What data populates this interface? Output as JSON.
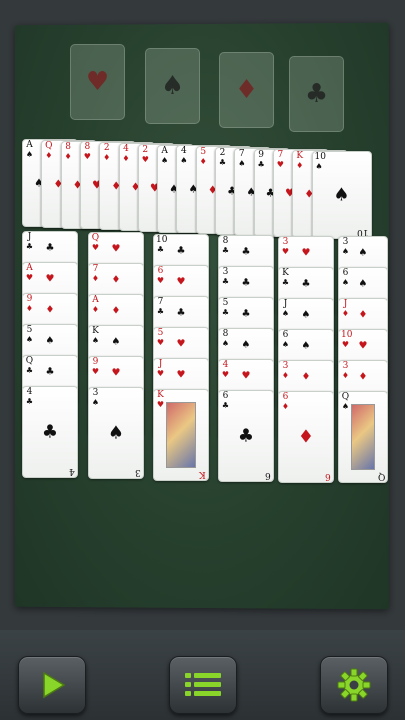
{
  "foundations": [
    {
      "suit": "♥",
      "color": "#7a1a1a",
      "icon": "heart-icon"
    },
    {
      "suit": "♠",
      "color": "#1a1a1a",
      "icon": "spade-icon"
    },
    {
      "suit": "♦",
      "color": "#7a1a1a",
      "icon": "diamond-icon"
    },
    {
      "suit": "♣",
      "color": "#1a1a1a",
      "icon": "club-icon"
    }
  ],
  "reserve": [
    {
      "rank": "A",
      "suit": "♠",
      "red": false
    },
    {
      "rank": "Q",
      "suit": "♦",
      "red": true
    },
    {
      "rank": "8",
      "suit": "♦",
      "red": true
    },
    {
      "rank": "8",
      "suit": "♥",
      "red": true
    },
    {
      "rank": "2",
      "suit": "♦",
      "red": true
    },
    {
      "rank": "4",
      "suit": "♦",
      "red": true
    },
    {
      "rank": "2",
      "suit": "♥",
      "red": true
    },
    {
      "rank": "A",
      "suit": "♠",
      "red": false
    },
    {
      "rank": "4",
      "suit": "♠",
      "red": false
    },
    {
      "rank": "5",
      "suit": "♦",
      "red": true
    },
    {
      "rank": "2",
      "suit": "♣",
      "red": false
    },
    {
      "rank": "7",
      "suit": "♠",
      "red": false
    },
    {
      "rank": "9",
      "suit": "♣",
      "red": false
    },
    {
      "rank": "7",
      "suit": "♥",
      "red": true
    },
    {
      "rank": "K",
      "suit": "♦",
      "red": true
    },
    {
      "rank": "10",
      "suit": "♠",
      "red": false
    }
  ],
  "tableau": [
    [
      {
        "rank": "J",
        "suit": "♣",
        "red": false
      },
      {
        "rank": "A",
        "suit": "♥",
        "red": true
      },
      {
        "rank": "9",
        "suit": "♦",
        "red": true
      },
      {
        "rank": "5",
        "suit": "♠",
        "red": false
      },
      {
        "rank": "Q",
        "suit": "♣",
        "red": false
      },
      {
        "rank": "4",
        "suit": "♣",
        "red": false
      }
    ],
    [
      {
        "rank": "Q",
        "suit": "♥",
        "red": true
      },
      {
        "rank": "7",
        "suit": "♦",
        "red": true
      },
      {
        "rank": "A",
        "suit": "♦",
        "red": true
      },
      {
        "rank": "K",
        "suit": "♠",
        "red": false
      },
      {
        "rank": "9",
        "suit": "♥",
        "red": true
      },
      {
        "rank": "3",
        "suit": "♠",
        "red": false
      }
    ],
    [
      {
        "rank": "10",
        "suit": "♣",
        "red": false
      },
      {
        "rank": "6",
        "suit": "♥",
        "red": true
      },
      {
        "rank": "7",
        "suit": "♣",
        "red": false
      },
      {
        "rank": "5",
        "suit": "♥",
        "red": true
      },
      {
        "rank": "J",
        "suit": "♥",
        "red": true
      },
      {
        "rank": "K",
        "suit": "♥",
        "red": true
      }
    ],
    [
      {
        "rank": "8",
        "suit": "♣",
        "red": false
      },
      {
        "rank": "3",
        "suit": "♣",
        "red": false
      },
      {
        "rank": "5",
        "suit": "♣",
        "red": false
      },
      {
        "rank": "8",
        "suit": "♠",
        "red": false
      },
      {
        "rank": "4",
        "suit": "♥",
        "red": true
      },
      {
        "rank": "6",
        "suit": "♣",
        "red": false
      }
    ],
    [
      {
        "rank": "3",
        "suit": "♥",
        "red": true
      },
      {
        "rank": "K",
        "suit": "♣",
        "red": false
      },
      {
        "rank": "J",
        "suit": "♠",
        "red": false
      },
      {
        "rank": "6",
        "suit": "♠",
        "red": false
      },
      {
        "rank": "3",
        "suit": "♦",
        "red": true
      },
      {
        "rank": "6",
        "suit": "♦",
        "red": true
      }
    ],
    [
      {
        "rank": "3",
        "suit": "♠",
        "red": false
      },
      {
        "rank": "6",
        "suit": "♠",
        "red": false
      },
      {
        "rank": "J",
        "suit": "♦",
        "red": true
      },
      {
        "rank": "10",
        "suit": "♥",
        "red": true
      },
      {
        "rank": "3",
        "suit": "♦",
        "red": true
      },
      {
        "rank": "Q",
        "suit": "♠",
        "red": false
      }
    ]
  ],
  "toolbar": {
    "play_icon": "play-icon",
    "menu_icon": "menu-list-icon",
    "settings_icon": "gear-icon",
    "accent": "#8ad52a"
  }
}
